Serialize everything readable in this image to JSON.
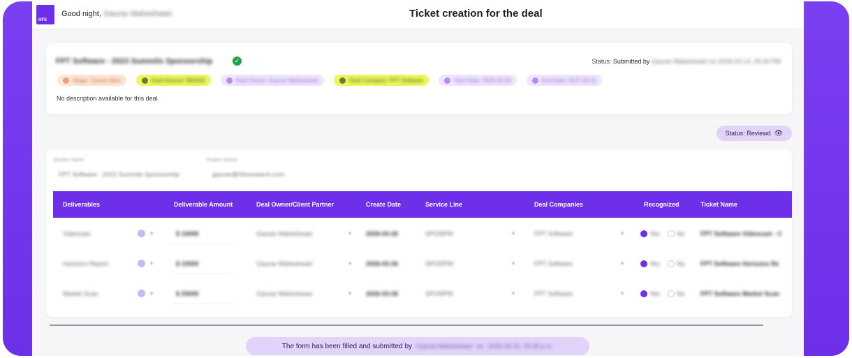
{
  "header": {
    "logo_text": "HFS",
    "greeting_prefix": "Good night,",
    "user_name": "Gaurav Maheshwari",
    "page_title": "Ticket creation for the deal"
  },
  "deal": {
    "title": "FPT Software - 2023 Summits Sponsorship",
    "status_label": "Status:",
    "status_value": "Submitted by",
    "status_detail": "Gaurav Maheshwari on 2026-03-13, 09:36 PM",
    "chips": [
      {
        "text": "Stage: Closed Won",
        "style": "orange"
      },
      {
        "text": "Deal Amount: $60000",
        "style": "yellow"
      },
      {
        "text": "Deal Owner: Gaurav Maheshwari",
        "style": "purple"
      },
      {
        "text": "Deal Company: FPT Software",
        "style": "yellow"
      },
      {
        "text": "Start Date: 2026-03-26",
        "style": "purple"
      },
      {
        "text": "End Date: 2027-03-31",
        "style": "purple"
      }
    ],
    "description": "No description available for this deal."
  },
  "review_badge": {
    "label": "Status: Reviewd",
    "icon": "eye-icon"
  },
  "form": {
    "section_label": "Section Name",
    "section_value": "FPT Software - 2023 Summits Sponsorship",
    "project_label": "Project Owner",
    "project_value": "gaurav@hfsresearch.com",
    "columns": [
      "Deliverables",
      "Deliverable Amount",
      "Deal Owner/Client Partner",
      "Create Date",
      "Service Line",
      "Deal Companies",
      "Recognized",
      "Ticket Name"
    ],
    "rows": [
      {
        "deliverable": "Videocast",
        "amount": "$ 10000",
        "owner": "Gaurav Maheshwari",
        "date": "2026-03-26",
        "service": "SPONPW",
        "company": "FPT Software",
        "yes": "Yes",
        "no": "No",
        "ticket": "FPT Software Videocast - C"
      },
      {
        "deliverable": "Horizons Report",
        "amount": "$ 15000",
        "owner": "Gaurav Maheshwari",
        "date": "2026-03-26",
        "service": "SPONPW",
        "company": "FPT Software",
        "yes": "Yes",
        "no": "No",
        "ticket": "FPT Software Horizons Re"
      },
      {
        "deliverable": "Market Scan",
        "amount": "$ 25000",
        "owner": "Gaurav Maheshwari",
        "date": "2026-03-26",
        "service": "SPONPW",
        "company": "FPT Software",
        "yes": "Yes",
        "no": "No",
        "ticket": "FPT Software Market Scan"
      }
    ]
  },
  "footer": {
    "prefix": "The form has been filled and submitted by",
    "name": "Gaurav Maheshwari",
    "on": "on",
    "timestamp": "2026-03-15, 09:36 p.m."
  }
}
